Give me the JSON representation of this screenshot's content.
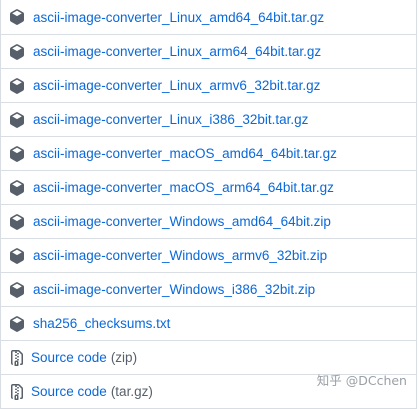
{
  "assets": [
    {
      "icon": "package-icon",
      "name": "ascii-image-converter_Linux_amd64_64bit.tar.gz"
    },
    {
      "icon": "package-icon",
      "name": "ascii-image-converter_Linux_arm64_64bit.tar.gz"
    },
    {
      "icon": "package-icon",
      "name": "ascii-image-converter_Linux_armv6_32bit.tar.gz"
    },
    {
      "icon": "package-icon",
      "name": "ascii-image-converter_Linux_i386_32bit.tar.gz"
    },
    {
      "icon": "package-icon",
      "name": "ascii-image-converter_macOS_amd64_64bit.tar.gz"
    },
    {
      "icon": "package-icon",
      "name": "ascii-image-converter_macOS_arm64_64bit.tar.gz"
    },
    {
      "icon": "package-icon",
      "name": "ascii-image-converter_Windows_amd64_64bit.zip"
    },
    {
      "icon": "package-icon",
      "name": "ascii-image-converter_Windows_armv6_32bit.zip"
    },
    {
      "icon": "package-icon",
      "name": "ascii-image-converter_Windows_i386_32bit.zip"
    },
    {
      "icon": "package-icon",
      "name": "sha256_checksums.txt"
    }
  ],
  "source_code": [
    {
      "icon": "file-zip-icon",
      "label": "Source code",
      "ext": "(zip)"
    },
    {
      "icon": "file-zip-icon",
      "label": "Source code",
      "ext": "(tar.gz)"
    }
  ],
  "watermark": "知乎 @DCchen",
  "colors": {
    "link": "#0969da",
    "muted": "#57606a",
    "border": "#d8dee4",
    "icon": "#57606a"
  }
}
